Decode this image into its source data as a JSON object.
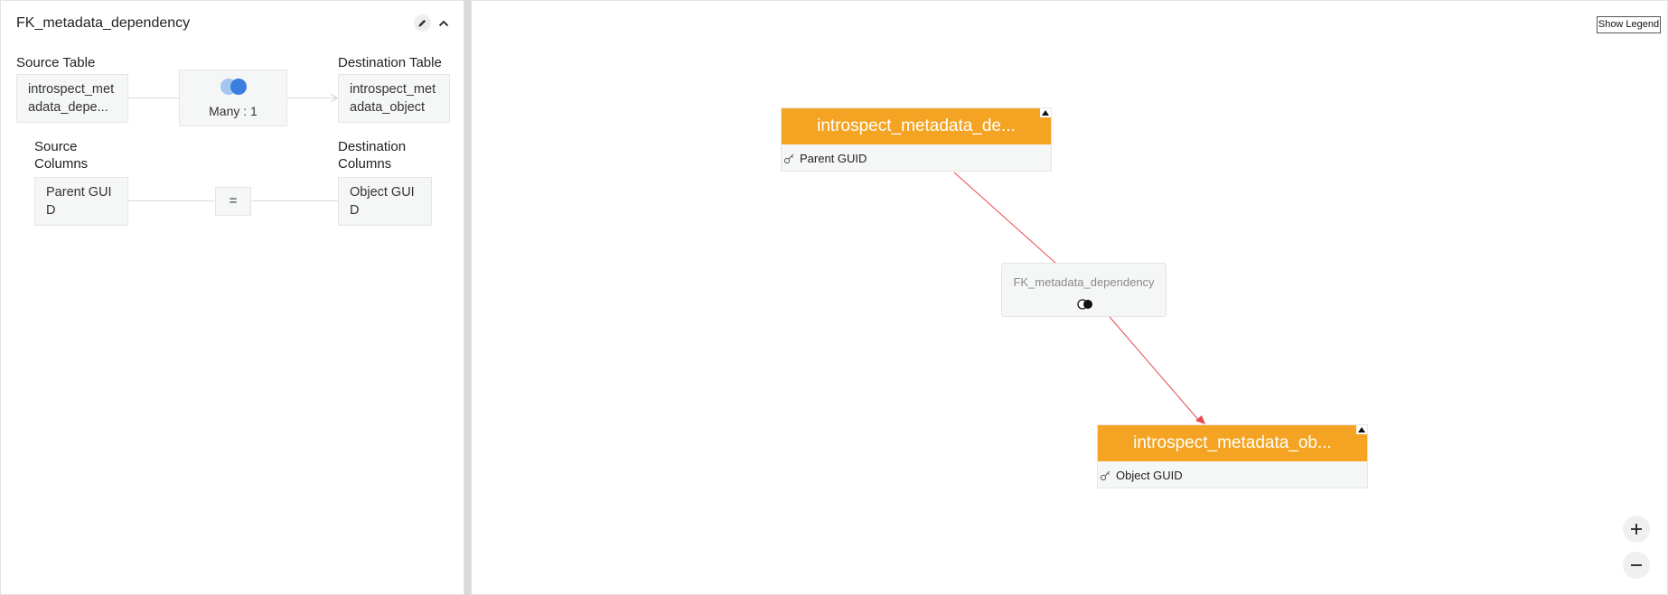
{
  "panel": {
    "title": "FK_metadata_dependency",
    "source_table_label": "Source Table",
    "destination_table_label": "Destination Table",
    "source_table_value": "introspect_metadata_depe...",
    "destination_table_value": "introspect_metadata_object",
    "cardinality": "Many : 1",
    "source_columns_label": "Source Columns",
    "destination_columns_label": "Destination Columns",
    "source_column_value": "Parent GUID",
    "operator": "=",
    "destination_column_value": "Object GUID"
  },
  "canvas": {
    "legend_button": "Show Legend",
    "source_node": {
      "title": "introspect_metadata_de...",
      "column": "Parent GUID"
    },
    "destination_node": {
      "title": "introspect_metadata_ob...",
      "column": "Object GUID"
    },
    "relationship_node": {
      "label": "FK_metadata_dependency"
    },
    "edge_color": "#e8494f",
    "node_header_color": "#f4a422"
  },
  "icons": {
    "edit": "pencil-icon",
    "collapse": "chevron-up-icon",
    "cardinality": "overlapping-circles-icon",
    "key": "key-icon",
    "zoom_in": "plus-icon",
    "zoom_out": "minus-icon"
  }
}
